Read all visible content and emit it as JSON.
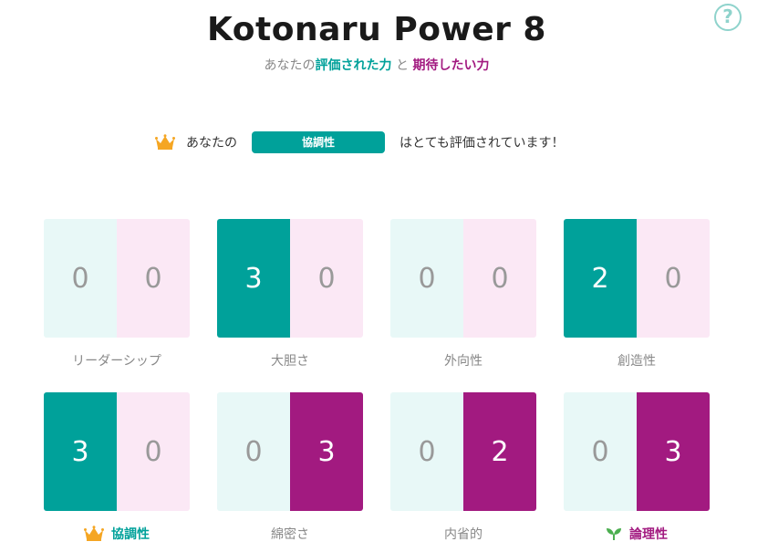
{
  "header": {
    "title": "Kotonaru Power 8",
    "subtitle": {
      "prefix": "あなたの",
      "evaluated": "評価された力",
      "connector": " と ",
      "expected": "期待したい力"
    },
    "help_symbol": "?"
  },
  "message": {
    "icon": "crown-icon",
    "prefix": "あなたの",
    "highlight": "協調性",
    "suffix": "はとても評価されています！"
  },
  "colors": {
    "evaluated": "#00a19a",
    "evaluated_light": "#e8f8f7",
    "expected": "#a21a80",
    "expected_light": "#fbe8f5",
    "crown": "#f5a623",
    "leaf": "#4caf50",
    "help": "#8fd3cc"
  },
  "powers": [
    {
      "label": "リーダーシップ",
      "evaluated": "0",
      "expected": "0",
      "evaluated_on": false,
      "expected_on": false
    },
    {
      "label": "大胆さ",
      "evaluated": "3",
      "expected": "0",
      "evaluated_on": true,
      "expected_on": false
    },
    {
      "label": "外向性",
      "evaluated": "0",
      "expected": "0",
      "evaluated_on": false,
      "expected_on": false
    },
    {
      "label": "創造性",
      "evaluated": "2",
      "expected": "0",
      "evaluated_on": true,
      "expected_on": false
    },
    {
      "label": "協調性",
      "evaluated": "3",
      "expected": "0",
      "evaluated_on": true,
      "expected_on": false,
      "badge": "crown-icon"
    },
    {
      "label": "綿密さ",
      "evaluated": "0",
      "expected": "3",
      "evaluated_on": false,
      "expected_on": true
    },
    {
      "label": "内省的",
      "evaluated": "0",
      "expected": "2",
      "evaluated_on": false,
      "expected_on": true
    },
    {
      "label": "論理性",
      "evaluated": "0",
      "expected": "3",
      "evaluated_on": false,
      "expected_on": true,
      "badge": "leaf-icon"
    }
  ]
}
